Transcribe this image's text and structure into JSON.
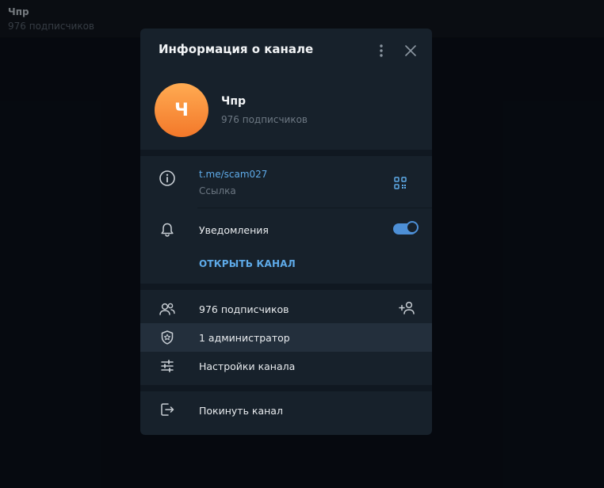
{
  "background": {
    "chat_title": "Чпр",
    "chat_subtitle": "976 подписчиков"
  },
  "modal": {
    "title": "Информация о канале",
    "avatar_letter": "Ч",
    "channel_name": "Чпр",
    "subscribers_text": "976 подписчиков",
    "link_value": "t.me/scam027",
    "link_label": "Ссылка",
    "notifications_label": "Уведомления",
    "notifications_enabled": true,
    "open_channel_label": "ОТКРЫТЬ КАНАЛ",
    "menu": [
      {
        "label": "976 подписчиков",
        "icon": "users-icon"
      },
      {
        "label": "1 администратор",
        "icon": "shield-icon"
      },
      {
        "label": "Настройки канала",
        "icon": "sliders-icon"
      }
    ],
    "leave_label": "Покинуть канал"
  },
  "colors": {
    "accent": "#5eaae8",
    "avatar_top": "#ffab52",
    "avatar_bottom": "#f3782a",
    "panel": "#17212b"
  }
}
